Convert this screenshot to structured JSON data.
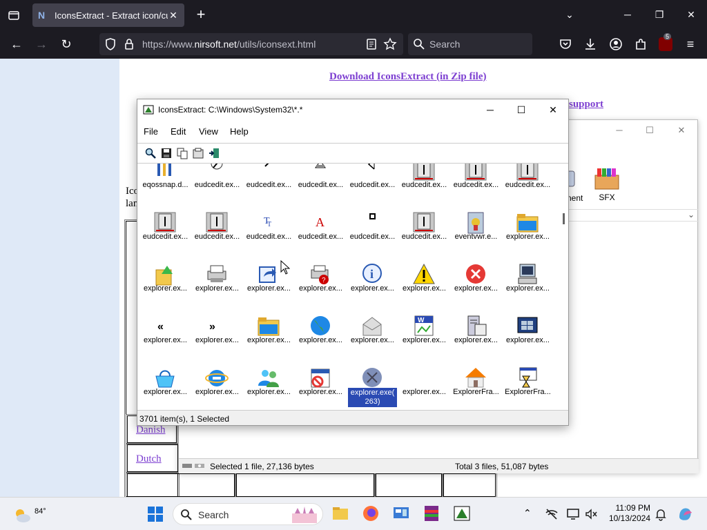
{
  "browser": {
    "tab_title": "IconsExtract - Extract icon/curs",
    "tab_favicon": "N",
    "url_prefix": "https://www.",
    "url_domain": "nirsoft.net",
    "url_path": "/utils/iconsext.html",
    "search_placeholder": "Search",
    "extensions_badge": "5"
  },
  "page": {
    "download_link": "Download IconsExtract (in Zip file)",
    "support_link": "support",
    "text_line1": "Ico",
    "text_line2": "lan",
    "lang_rows": [
      "Danish",
      "Dutch"
    ]
  },
  "bg_window": {
    "icon_labels": [
      "nent",
      "SFX"
    ],
    "status_left": "Selected 1 file, 27,136 bytes",
    "status_right": "Total 3 files, 51,087 bytes"
  },
  "iconsext": {
    "title": "IconsExtract:   C:\\Windows\\System32\\*.*",
    "menu": [
      "File",
      "Edit",
      "View",
      "Help"
    ],
    "status": "3701 item(s), 1 Selected",
    "items": [
      {
        "label": "eqossnap.d...",
        "icon": "network-icon"
      },
      {
        "label": "eudcedit.ex...",
        "icon": "pen-icon"
      },
      {
        "label": "eudcedit.ex...",
        "icon": "brush-icon"
      },
      {
        "label": "eudcedit.ex...",
        "icon": "fill-icon"
      },
      {
        "label": "eudcedit.ex...",
        "icon": "arrow-icon"
      },
      {
        "label": "eudcedit.ex...",
        "icon": "char-icon"
      },
      {
        "label": "eudcedit.ex...",
        "icon": "char-icon"
      },
      {
        "label": "eudcedit.ex...",
        "icon": "char-icon"
      },
      {
        "label": "eudcedit.ex...",
        "icon": "char-icon"
      },
      {
        "label": "eudcedit.ex...",
        "icon": "char-icon"
      },
      {
        "label": "eudcedit.ex...",
        "icon": "tt-icon"
      },
      {
        "label": "eudcedit.ex...",
        "icon": "a-icon"
      },
      {
        "label": "eudcedit.ex...",
        "icon": "dot-icon"
      },
      {
        "label": "eudcedit.ex...",
        "icon": "char-icon"
      },
      {
        "label": "eventvwr.e...",
        "icon": "event-icon"
      },
      {
        "label": "explorer.ex...",
        "icon": "folder-icon"
      },
      {
        "label": "explorer.ex...",
        "icon": "folder-up-icon"
      },
      {
        "label": "explorer.ex...",
        "icon": "printer-icon"
      },
      {
        "label": "explorer.ex...",
        "icon": "shortcut-icon"
      },
      {
        "label": "explorer.ex...",
        "icon": "printer-help-icon"
      },
      {
        "label": "explorer.ex...",
        "icon": "info-icon"
      },
      {
        "label": "explorer.ex...",
        "icon": "warning-icon"
      },
      {
        "label": "explorer.ex...",
        "icon": "error-icon"
      },
      {
        "label": "explorer.ex...",
        "icon": "computer-icon"
      },
      {
        "label": "explorer.ex...",
        "icon": "rewind-icon"
      },
      {
        "label": "explorer.ex...",
        "icon": "forward-icon"
      },
      {
        "label": "explorer.ex...",
        "icon": "folder-icon"
      },
      {
        "label": "explorer.ex...",
        "icon": "globe-icon"
      },
      {
        "label": "explorer.ex...",
        "icon": "mail-icon"
      },
      {
        "label": "explorer.ex...",
        "icon": "word-doc-icon"
      },
      {
        "label": "explorer.ex...",
        "icon": "server-icon"
      },
      {
        "label": "explorer.ex...",
        "icon": "windows-icon"
      },
      {
        "label": "explorer.ex...",
        "icon": "basket-icon"
      },
      {
        "label": "explorer.ex...",
        "icon": "ie-icon"
      },
      {
        "label": "explorer.ex...",
        "icon": "users-icon"
      },
      {
        "label": "explorer.ex...",
        "icon": "blocked-icon"
      },
      {
        "label": "explorer.exe( 263)",
        "icon": "selected-disc-icon",
        "selected": true
      },
      {
        "label": "explorer.ex...",
        "icon": "blank-icon"
      },
      {
        "label": "ExplorerFra...",
        "icon": "home-icon"
      },
      {
        "label": "ExplorerFra...",
        "icon": "hourglass-window-icon"
      }
    ]
  },
  "taskbar": {
    "weather_temp": "84°",
    "search_label": "Search",
    "time": "11:09 PM",
    "date": "10/13/2024"
  }
}
